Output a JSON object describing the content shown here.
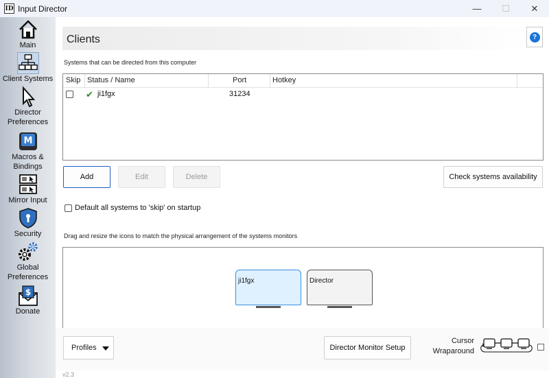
{
  "window": {
    "title": "Input Director",
    "icon_text": "ID",
    "minimize": "—",
    "maximize": "☐",
    "close": "✕"
  },
  "sidebar": {
    "items": [
      {
        "label": "Main",
        "icon": "home-icon"
      },
      {
        "label": "Client Systems",
        "icon": "network-icon",
        "active": true
      },
      {
        "label": "Director Preferences",
        "icon": "cursor-icon"
      },
      {
        "label": "Macros & Bindings",
        "icon": "macro-icon"
      },
      {
        "label": "Mirror Input",
        "icon": "mirror-icon"
      },
      {
        "label": "Security",
        "icon": "shield-icon"
      },
      {
        "label": "Global Preferences",
        "icon": "gears-icon"
      },
      {
        "label": "Donate",
        "icon": "donate-icon"
      }
    ]
  },
  "main": {
    "title": "Clients",
    "help": "?",
    "systems_caption": "Systems that can be directed from this computer",
    "table": {
      "columns": [
        "Skip",
        "Status / Name",
        "Port",
        "Hotkey"
      ],
      "rows": [
        {
          "status": "✔",
          "name": "ji1fgx",
          "port": "31234",
          "hotkey": ""
        }
      ]
    },
    "buttons": {
      "add": "Add",
      "edit": "Edit",
      "delete": "Delete",
      "check": "Check systems availability"
    },
    "default_skip_label": "Default all systems to 'skip' on startup",
    "arrange_caption": "Drag and resize the icons to match the physical arrangement of the systems monitors",
    "monitors": [
      {
        "name": "ji1fgx"
      },
      {
        "name": "Director"
      }
    ],
    "bottom": {
      "profiles": "Profiles",
      "monitor_setup": "Director Monitor Setup",
      "cursor_wrap_line1": "Cursor",
      "cursor_wrap_line2": "Wraparound"
    },
    "version": "v2.3"
  },
  "colors": {
    "accent": "#1a73d9",
    "active_monitor": "#dff0ff",
    "status_ok": "#2a8a2a"
  }
}
